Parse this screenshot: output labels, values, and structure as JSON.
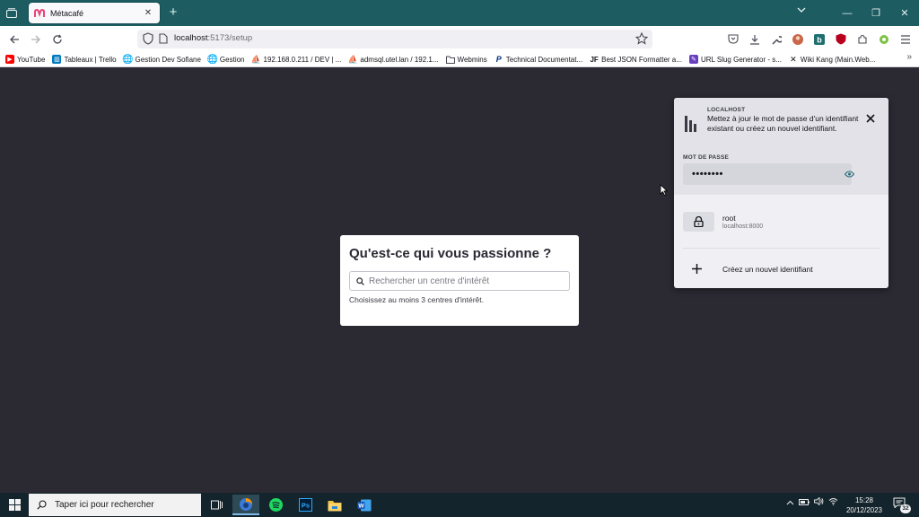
{
  "browser": {
    "tab": {
      "title": "Métacafé",
      "favicon": "metacafe-favicon"
    },
    "url": {
      "host": "localhost",
      "rest": ":5173/setup"
    },
    "bookmarks": [
      {
        "label": "YouTube",
        "icon": "youtube-icon",
        "color": "#ff0000"
      },
      {
        "label": "Tableaux | Trello",
        "icon": "trello-icon",
        "color": "#0079bf"
      },
      {
        "label": "Gestion Dev Sofiane",
        "icon": "globe-icon",
        "color": "#5b5b66"
      },
      {
        "label": "Gestion",
        "icon": "globe-icon",
        "color": "#5b5b66"
      },
      {
        "label": "192.168.0.211 / DEV | ...",
        "icon": "phpmyadmin-icon",
        "color": "#f29111"
      },
      {
        "label": "admsql.utel.lan / 192.1...",
        "icon": "phpmyadmin-icon",
        "color": "#f29111"
      },
      {
        "label": "Webmins",
        "icon": "folder-icon",
        "color": "#5b5b66"
      },
      {
        "label": "Technical Documentat...",
        "icon": "paypal-icon",
        "color": "#003087"
      },
      {
        "label": "Best JSON Formatter a...",
        "icon": "jf-icon",
        "color": "#15141a"
      },
      {
        "label": "URL Slug Generator - s...",
        "icon": "slug-icon",
        "color": "#6a3fbf"
      },
      {
        "label": "Wiki Kang (Main.Web...",
        "icon": "x-icon",
        "color": "#15141a"
      }
    ]
  },
  "setup": {
    "title": "Qu'est-ce qui vous passionne ?",
    "search_placeholder": "Rechercher un centre d'intérêt",
    "hint": "Choisissez au moins 3 centres d'intérêt."
  },
  "password_popup": {
    "host": "LOCALHOST",
    "message": "Mettez à jour le mot de passe d'un identifiant existant ou créez un nouvel identifiant.",
    "password_label": "MOT DE PASSE",
    "password_mask": "••••••••",
    "entry": {
      "username": "root",
      "host": "localhost:8000"
    },
    "create_label": "Créez un nouvel identifiant"
  },
  "taskbar": {
    "search_placeholder": "Taper ici pour rechercher",
    "time": "15:28",
    "date": "20/12/2023",
    "notification_count": "32"
  }
}
